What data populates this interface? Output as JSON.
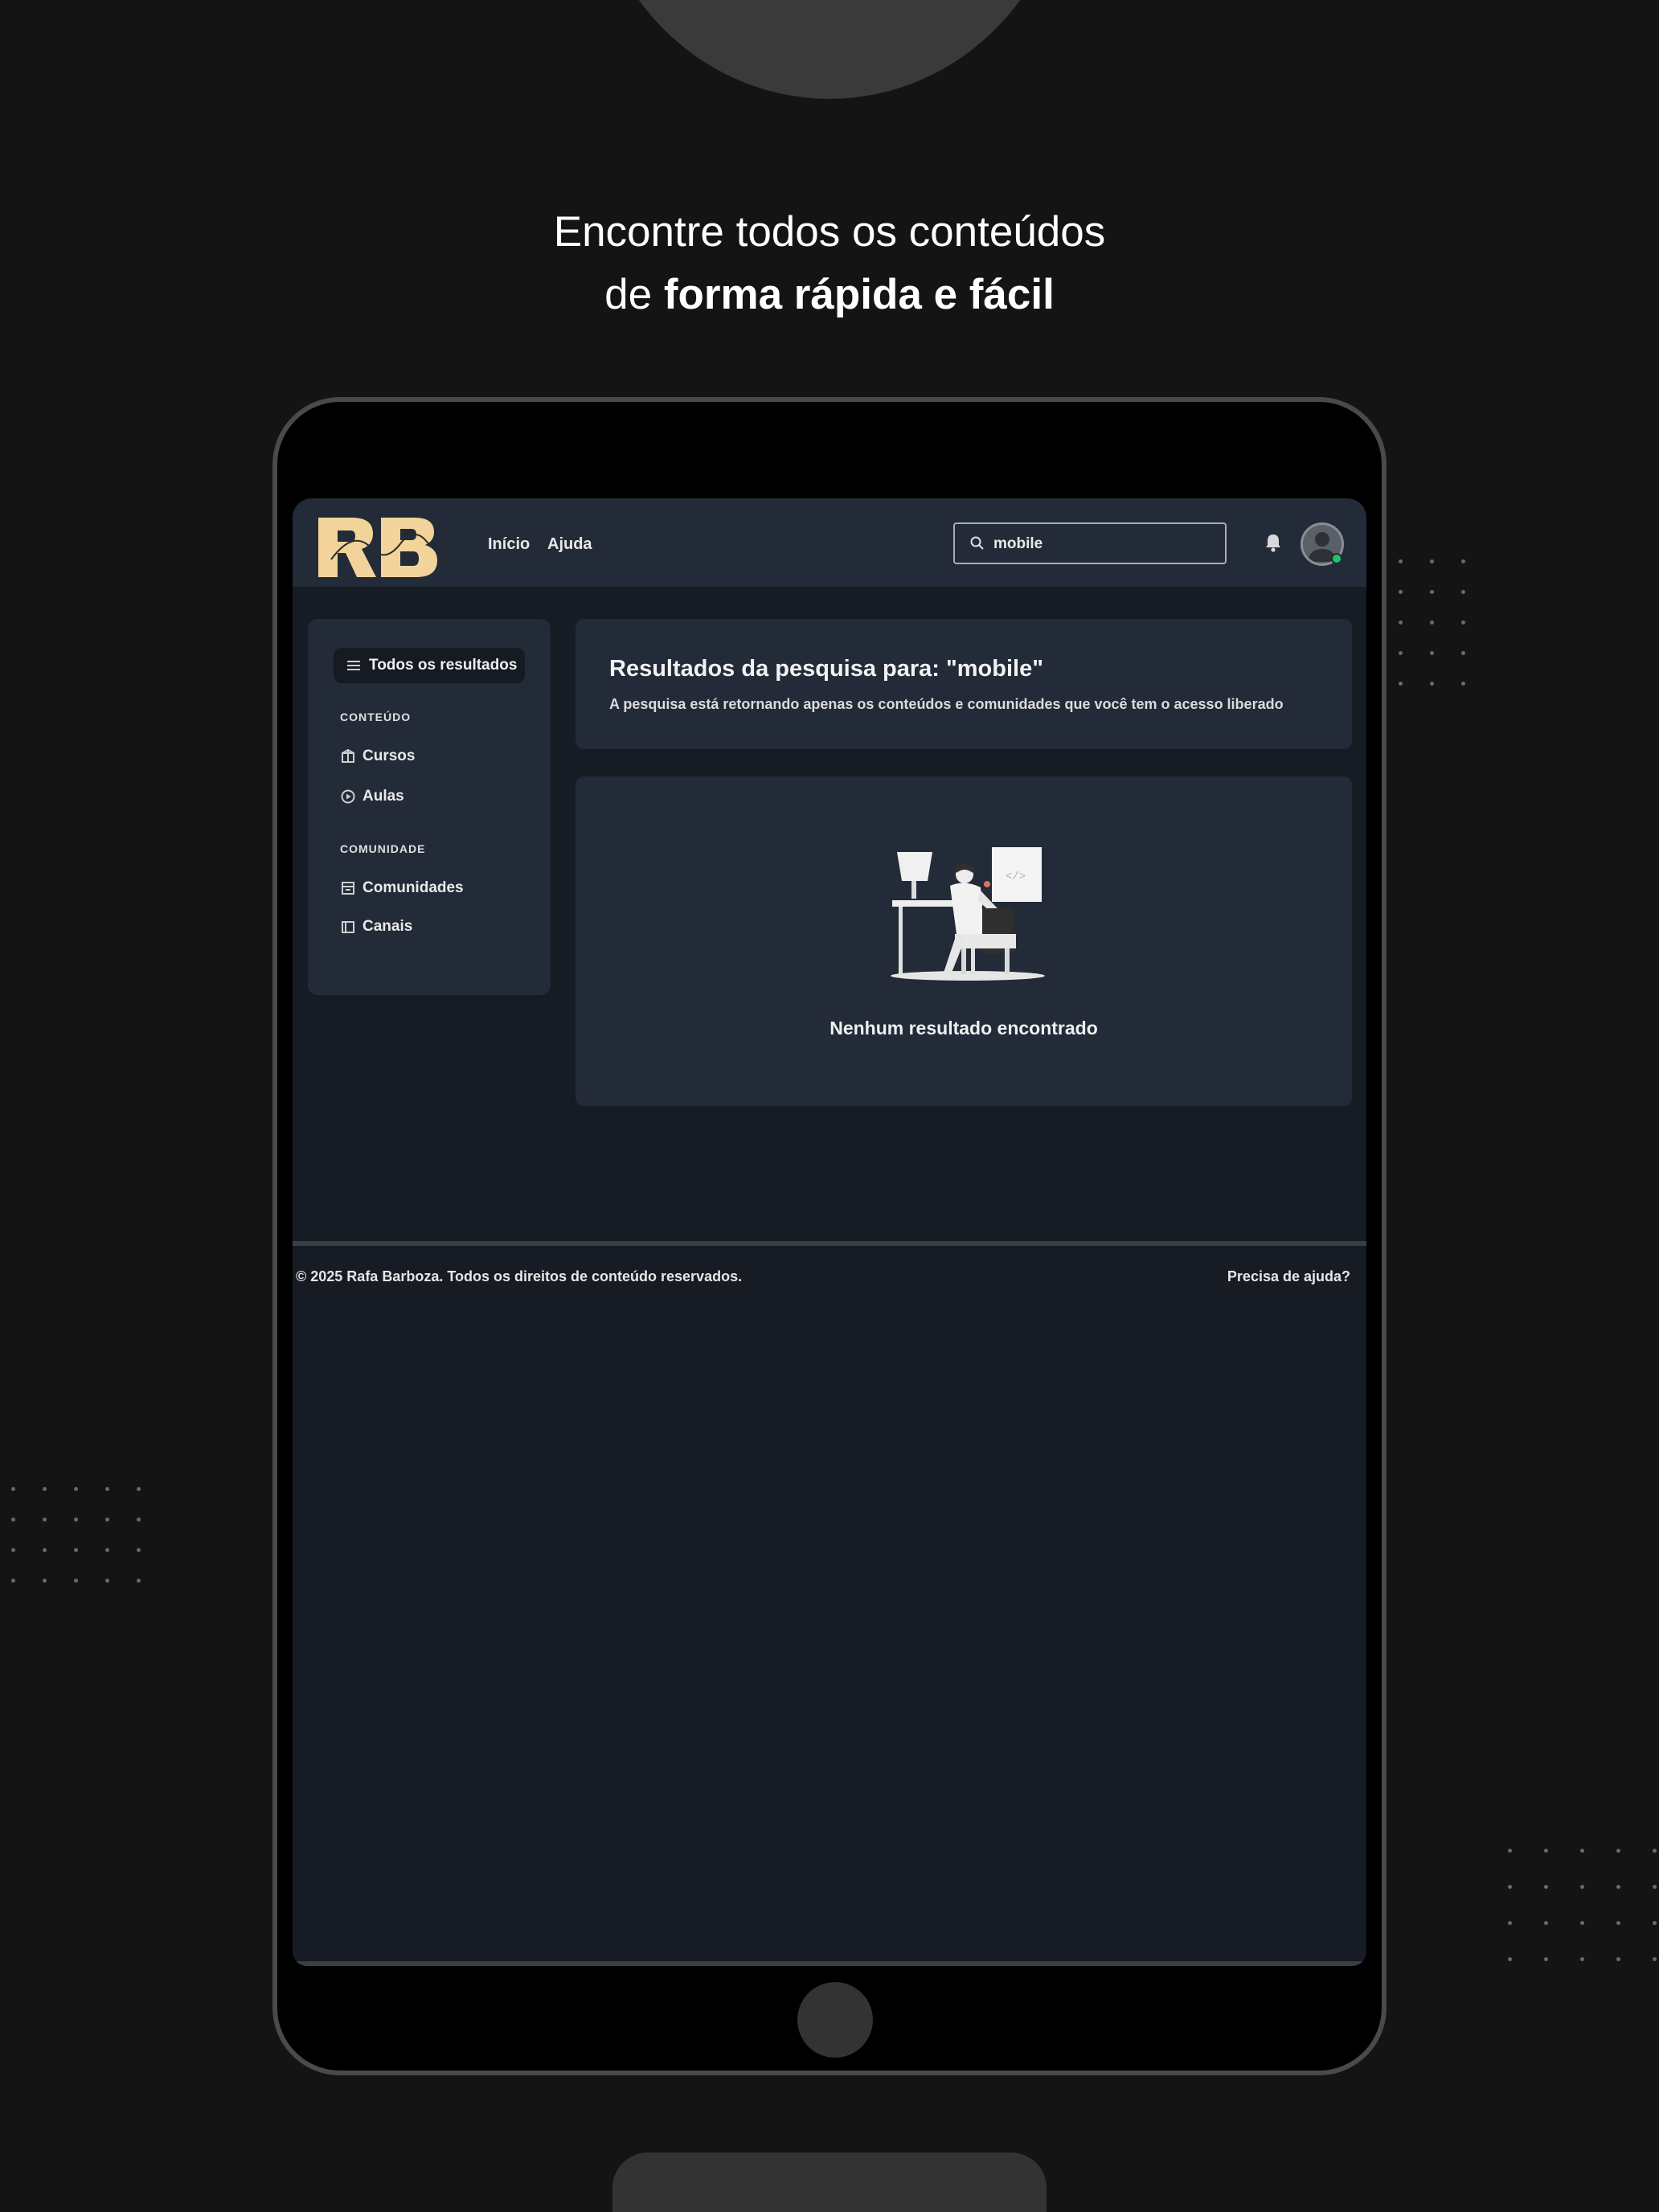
{
  "headline": {
    "line1": "Encontre todos os conteúdos",
    "line2_prefix": "de ",
    "line2_bold": "forma rápida e fácil"
  },
  "header": {
    "logo": "RB",
    "nav": [
      "Início",
      "Ajuda"
    ],
    "search": {
      "value": "mobile"
    }
  },
  "sidebar": {
    "all_results": "Todos os resultados",
    "sections": [
      {
        "title": "CONTEÚDO",
        "items": [
          {
            "label": "Cursos",
            "icon": "box-icon"
          },
          {
            "label": "Aulas",
            "icon": "play-circle-icon"
          }
        ]
      },
      {
        "title": "COMUNIDADE",
        "items": [
          {
            "label": "Comunidades",
            "icon": "community-icon"
          },
          {
            "label": "Canais",
            "icon": "channel-icon"
          }
        ]
      }
    ]
  },
  "results": {
    "title": "Resultados da pesquisa para: \"mobile\"",
    "subtitle": "A pesquisa está retornando apenas os conteúdos e comunidades que você tem o acesso liberado"
  },
  "empty_state": {
    "message": "Nenhum resultado encontrado"
  },
  "footer": {
    "copyright": "© 2025 Rafa Barboza. Todos os direitos de conteúdo reservados.",
    "help": "Precisa de ajuda?"
  },
  "colors": {
    "page_bg": "#141414",
    "screen_bg": "#171b24",
    "card_bg": "#222b37",
    "logo_gold": "#f2d49a",
    "online": "#23c267"
  }
}
